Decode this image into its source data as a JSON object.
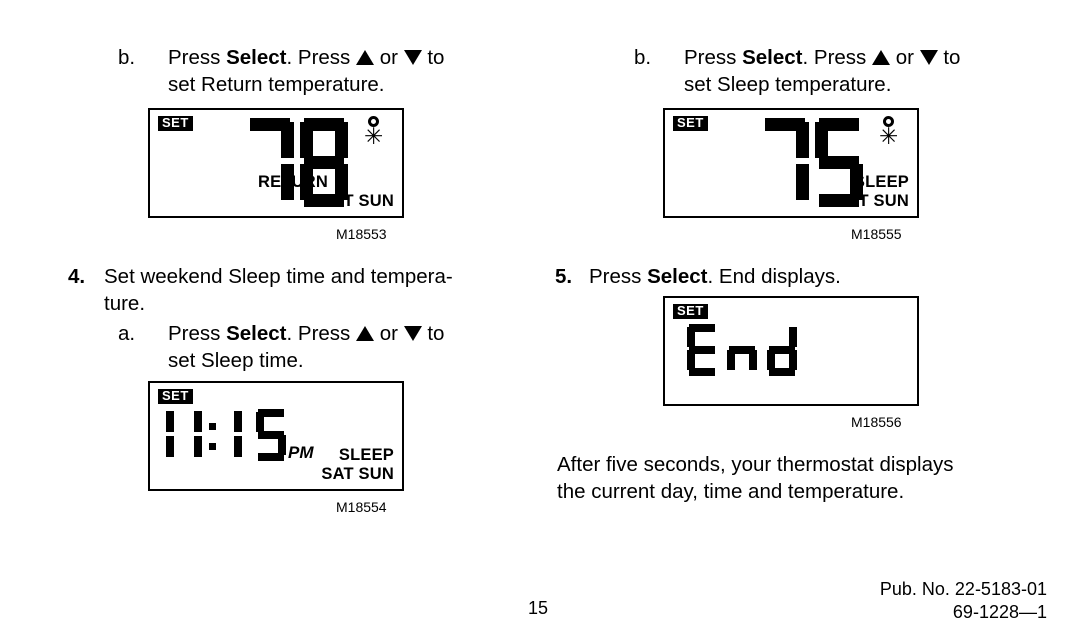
{
  "page": {
    "number": "15",
    "footer_line1": "Pub. No. 22-5183-01",
    "footer_line2": "69-1228—1"
  },
  "left_column": {
    "step_b_top": {
      "marker": "b.",
      "line1_pre": "Press ",
      "line1_bold": "Select",
      "line1_mid": ". Press ",
      "line1_or": " or ",
      "line1_post": " to",
      "line2": "set Return temperature."
    },
    "display_return": {
      "badge": "SET",
      "digits": "78",
      "degree_icon": "degree-icon",
      "snowflake_icon": "✳",
      "label_mode": "RETURN",
      "label_days": "SAT SUN",
      "caption": "M18553"
    },
    "step_4": {
      "marker": "4.",
      "line1": "Set weekend Sleep time and tempera-",
      "line2": "ture."
    },
    "step_4a": {
      "marker": "a.",
      "line1_pre": "Press ",
      "line1_bold": "Select",
      "line1_mid": ". Press ",
      "line1_or": " or ",
      "line1_post": " to",
      "line2": "set Sleep time."
    },
    "display_time": {
      "badge": "SET",
      "digits": "11:15",
      "meridiem": "PM",
      "label_mode": "SLEEP",
      "label_days": "SAT SUN",
      "caption": "M18554"
    }
  },
  "right_column": {
    "step_b_top": {
      "marker": "b.",
      "line1_pre": "Press ",
      "line1_bold": "Select",
      "line1_mid": ". Press ",
      "line1_or": " or ",
      "line1_post": " to",
      "line2": "set Sleep temperature."
    },
    "display_sleep": {
      "badge": "SET",
      "digits": "75",
      "degree_icon": "degree-icon",
      "snowflake_icon": "✳",
      "label_mode": "SLEEP",
      "label_days": "SAT SUN",
      "caption": "M18555"
    },
    "step_5": {
      "marker": "5.",
      "line1_pre": "Press ",
      "line1_bold": "Select",
      "line1_post": ". End displays."
    },
    "display_end": {
      "badge": "SET",
      "digits": "End",
      "caption": "M18556"
    },
    "closing": {
      "line1": "After five seconds, your thermostat displays",
      "line2": "the current day, time and temperature."
    }
  }
}
